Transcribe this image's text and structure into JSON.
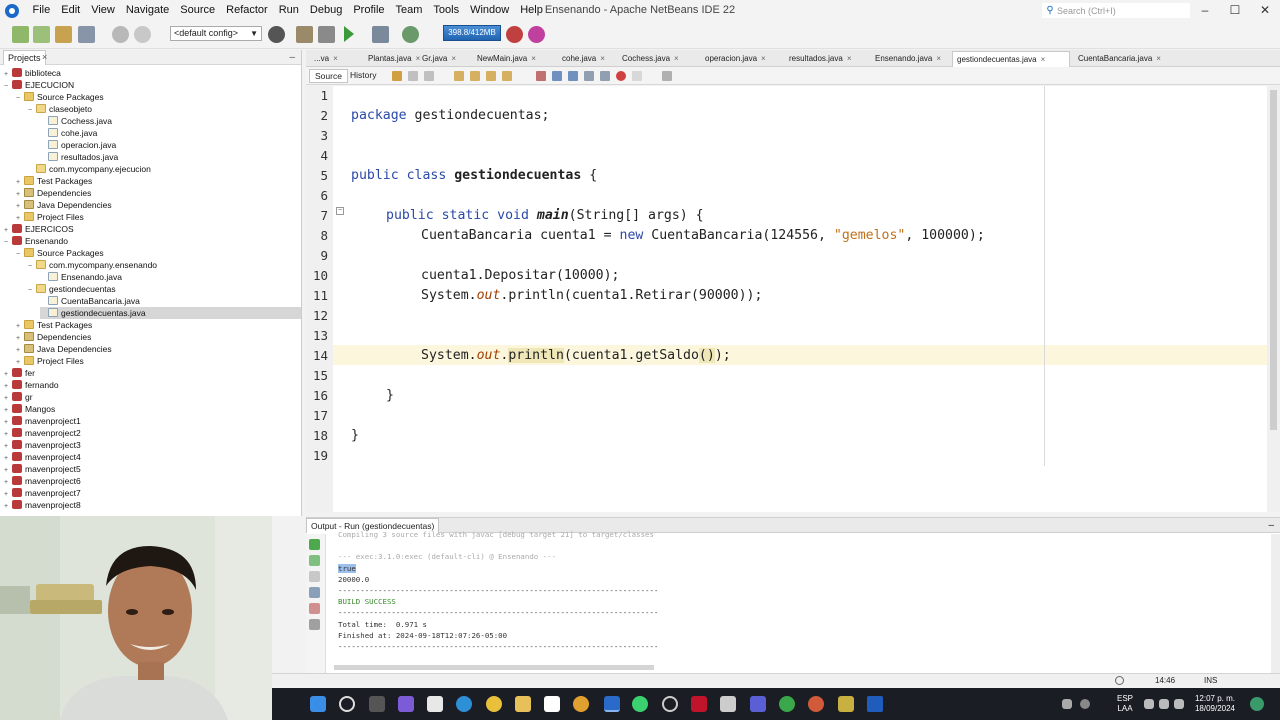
{
  "window": {
    "title": "Ensenando - Apache NetBeans IDE 22",
    "search_placeholder": "Search (Ctrl+I)",
    "controls": [
      "–",
      "☐",
      "✕"
    ]
  },
  "menu": [
    "File",
    "Edit",
    "View",
    "Navigate",
    "Source",
    "Refactor",
    "Run",
    "Debug",
    "Profile",
    "Team",
    "Tools",
    "Window",
    "Help"
  ],
  "toolbar": {
    "config": "<default config>",
    "memory": "398.8/412MB"
  },
  "projects": {
    "tab_label": "Projects",
    "close": "×",
    "minimize": "–",
    "tree": [
      {
        "label": "biblioteca",
        "icon": "proj",
        "depth": 0,
        "twisty": "+"
      },
      {
        "label": "EJECUCION",
        "icon": "proj",
        "depth": 0,
        "twisty": "−"
      },
      {
        "label": "Source Packages",
        "icon": "folder",
        "depth": 1,
        "twisty": "−"
      },
      {
        "label": "claseobjeto",
        "icon": "pkg",
        "depth": 2,
        "twisty": "−"
      },
      {
        "label": "Cochess.java",
        "icon": "java",
        "depth": 3,
        "twisty": ""
      },
      {
        "label": "cohe.java",
        "icon": "java",
        "depth": 3,
        "twisty": ""
      },
      {
        "label": "operacion.java",
        "icon": "java",
        "depth": 3,
        "twisty": ""
      },
      {
        "label": "resultados.java",
        "icon": "java",
        "depth": 3,
        "twisty": ""
      },
      {
        "label": "com.mycompany.ejecucion",
        "icon": "pkg",
        "depth": 2,
        "twisty": ""
      },
      {
        "label": "Test Packages",
        "icon": "folder",
        "depth": 1,
        "twisty": "+"
      },
      {
        "label": "Dependencies",
        "icon": "jar",
        "depth": 1,
        "twisty": "+"
      },
      {
        "label": "Java Dependencies",
        "icon": "jar",
        "depth": 1,
        "twisty": "+"
      },
      {
        "label": "Project Files",
        "icon": "folder",
        "depth": 1,
        "twisty": "+"
      },
      {
        "label": "EJERCICOS",
        "icon": "proj",
        "depth": 0,
        "twisty": "+"
      },
      {
        "label": "Ensenando",
        "icon": "proj",
        "depth": 0,
        "twisty": "−"
      },
      {
        "label": "Source Packages",
        "icon": "folder",
        "depth": 1,
        "twisty": "−"
      },
      {
        "label": "com.mycompany.ensenando",
        "icon": "pkg",
        "depth": 2,
        "twisty": "−"
      },
      {
        "label": "Ensenando.java",
        "icon": "java",
        "depth": 3,
        "twisty": ""
      },
      {
        "label": "gestiondecuentas",
        "icon": "pkg",
        "depth": 2,
        "twisty": "−"
      },
      {
        "label": "CuentaBancaria.java",
        "icon": "java",
        "depth": 3,
        "twisty": ""
      },
      {
        "label": "gestiondecuentas.java",
        "icon": "java",
        "depth": 3,
        "twisty": "",
        "selected": true
      },
      {
        "label": "Test Packages",
        "icon": "folder",
        "depth": 1,
        "twisty": "+"
      },
      {
        "label": "Dependencies",
        "icon": "jar",
        "depth": 1,
        "twisty": "+"
      },
      {
        "label": "Java Dependencies",
        "icon": "jar",
        "depth": 1,
        "twisty": "+"
      },
      {
        "label": "Project Files",
        "icon": "folder",
        "depth": 1,
        "twisty": "+"
      },
      {
        "label": "fer",
        "icon": "proj",
        "depth": 0,
        "twisty": "+"
      },
      {
        "label": "fernando",
        "icon": "proj",
        "depth": 0,
        "twisty": "+"
      },
      {
        "label": "gr",
        "icon": "proj",
        "depth": 0,
        "twisty": "+"
      },
      {
        "label": "Mangos",
        "icon": "proj",
        "depth": 0,
        "twisty": "+"
      },
      {
        "label": "mavenproject1",
        "icon": "proj",
        "depth": 0,
        "twisty": "+"
      },
      {
        "label": "mavenproject2",
        "icon": "proj",
        "depth": 0,
        "twisty": "+"
      },
      {
        "label": "mavenproject3",
        "icon": "proj",
        "depth": 0,
        "twisty": "+"
      },
      {
        "label": "mavenproject4",
        "icon": "proj",
        "depth": 0,
        "twisty": "+"
      },
      {
        "label": "mavenproject5",
        "icon": "proj",
        "depth": 0,
        "twisty": "+"
      },
      {
        "label": "mavenproject6",
        "icon": "proj",
        "depth": 0,
        "twisty": "+"
      },
      {
        "label": "mavenproject7",
        "icon": "proj",
        "depth": 0,
        "twisty": "+"
      },
      {
        "label": "mavenproject8",
        "icon": "proj",
        "depth": 0,
        "twisty": "+"
      }
    ]
  },
  "editor_tabs": [
    {
      "label": "...va"
    },
    {
      "label": "Plantas.java"
    },
    {
      "label": "Gr.java"
    },
    {
      "label": "NewMain.java"
    },
    {
      "label": "cohe.java"
    },
    {
      "label": "Cochess.java"
    },
    {
      "label": "operacion.java"
    },
    {
      "label": "resultados.java"
    },
    {
      "label": "Ensenando.java"
    },
    {
      "label": "gestiondecuentas.java",
      "active": true
    },
    {
      "label": "CuentaBancaria.java"
    }
  ],
  "editor": {
    "source_tab": "Source",
    "history_tab": "History",
    "line_numbers": [
      "1",
      "2",
      "3",
      "4",
      "5",
      "6",
      "7",
      "8",
      "9",
      "10",
      "11",
      "12",
      "13",
      "14",
      "15",
      "16",
      "17",
      "18",
      "19"
    ],
    "code": {
      "l2_kw": "package",
      "l2_rest": " gestiondecuentas;",
      "l5_kw": "public class",
      "l5_name": "gestiondecuentas",
      "l5_rest": " {",
      "l7_kw": "public static void",
      "l7_name": "main",
      "l7_rest": "(String[] args) {",
      "l8_a": "CuentaBancaria cuenta1 = ",
      "l8_kw": "new",
      "l8_b": " CuentaBancaria(124556, ",
      "l8_str": "\"gemelos\"",
      "l8_c": ", 100000);",
      "l10": "cuenta1.Depositar(10000);",
      "l11_a": "System.",
      "l11_out": "out",
      "l11_b": ".println(cuenta1.Retirar(90000));",
      "l14_a": "System.",
      "l14_out": "out",
      "l14_dot": ".",
      "l14_m": "println",
      "l14_b": "(cuenta1.getSaldo",
      "l14_p": "()",
      "l14_c": ");",
      "l16": "}",
      "l18": "}"
    }
  },
  "output": {
    "tab_label": "Output - Run (gestiondecuentas)",
    "minimize": "–",
    "lines": [
      {
        "text": "Compiling 3 source files with javac [debug target 21] to target/classes",
        "style": "dim"
      },
      {
        "text": "",
        "style": ""
      },
      {
        "text": "--- exec:3.1.0:exec (default-cli) @ Ensenando ---",
        "style": "dim"
      },
      {
        "text": "true",
        "style": "sel"
      },
      {
        "text": "20000.0",
        "style": ""
      },
      {
        "text": "------------------------------------------------------------------------",
        "style": ""
      },
      {
        "text": "BUILD SUCCESS",
        "style": "green"
      },
      {
        "text": "------------------------------------------------------------------------",
        "style": ""
      },
      {
        "text": "Total time:  0.971 s",
        "style": ""
      },
      {
        "text": "Finished at: 2024-09-18T12:07:26-05:00",
        "style": ""
      },
      {
        "text": "------------------------------------------------------------------------",
        "style": ""
      }
    ]
  },
  "status": {
    "position": "14:46",
    "mode": "INS"
  },
  "taskbar": {
    "lang": "ESP",
    "lang2": "LAA",
    "time": "12:07 p. m.",
    "date": "18/09/2024"
  },
  "colors": {
    "keyword": "#2a49a8",
    "string": "#c0701a",
    "build_success": "#3b8a2e",
    "current_line": "#fbf6dc",
    "taskbar": "#1a1d24"
  }
}
